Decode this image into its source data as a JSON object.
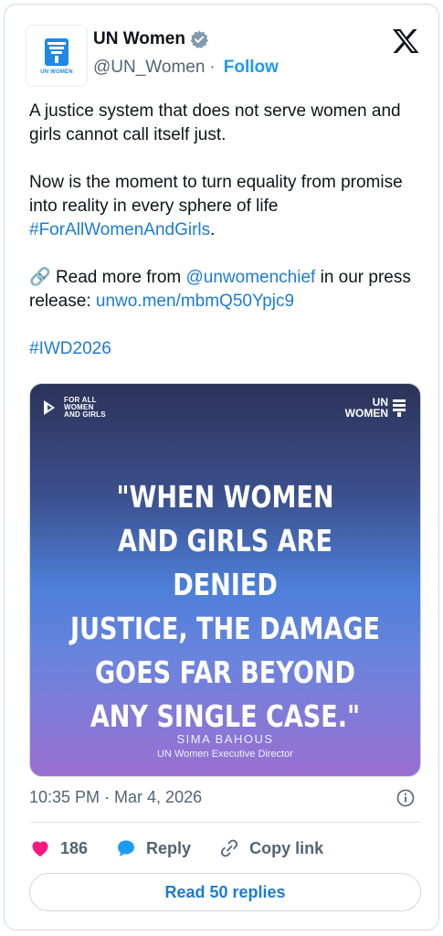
{
  "account": {
    "display_name": "UN Women",
    "handle": "@UN_Women",
    "separator": "·",
    "follow_label": "Follow",
    "avatar_text": "UN WOMEN"
  },
  "tweet": {
    "line1": "A justice system that does not serve women and girls cannot call itself just.",
    "line2": "Now is the moment to turn equality from promise into reality in every sphere of life ",
    "hashtag1": "#ForAllWomenAndGirls",
    "line2_end": ".",
    "link_emoji": "🔗",
    "line3_pre": " Read more from ",
    "mention": "@unwomenchief",
    "line3_mid": " in our press release: ",
    "url": "unwo.men/mbmQ50Ypjc9",
    "hashtag2": "#IWD2026"
  },
  "media": {
    "fa_logo_line1": "FOR ALL",
    "fa_logo_line2": "WOMEN",
    "fa_logo_line3": "AND GIRLS",
    "unw_logo_line1": "UN",
    "unw_logo_line2": "WOMEN",
    "quote": "\"WHEN WOMEN\nAND GIRLS ARE DENIED\nJUSTICE, THE DAMAGE\nGOES FAR BEYOND\nANY SINGLE CASE.\"",
    "speaker_name": "SIMA BAHOUS",
    "speaker_title": "UN Women Executive Director"
  },
  "meta": {
    "timestamp": "10:35 PM · Mar 4, 2026"
  },
  "actions": {
    "like_count": "186",
    "reply_label": "Reply",
    "copy_label": "Copy link"
  },
  "replies_button": "Read 50 replies",
  "colors": {
    "link": "#1d7bd4",
    "heart": "#f91880",
    "reply_bubble": "#1d9bf0",
    "muted": "#536471"
  },
  "icons": [
    "verified-badge-icon",
    "x-logo-icon",
    "link-icon",
    "info-icon",
    "heart-icon",
    "reply-icon",
    "copy-link-icon"
  ]
}
